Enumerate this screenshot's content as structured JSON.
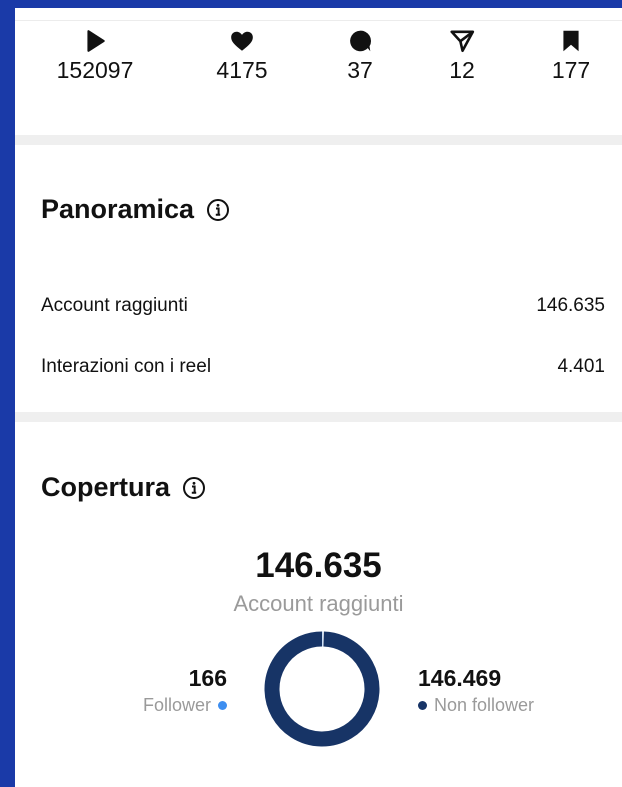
{
  "stats": [
    {
      "icon": "play-icon",
      "value": "152097"
    },
    {
      "icon": "heart-icon",
      "value": "4175"
    },
    {
      "icon": "comment-icon",
      "value": "37"
    },
    {
      "icon": "share-icon",
      "value": "12"
    },
    {
      "icon": "bookmark-icon",
      "value": "177"
    }
  ],
  "overview": {
    "title": "Panoramica",
    "rows": [
      {
        "label": "Account raggiunti",
        "value": "146.635"
      },
      {
        "label": "Interazioni con i reel",
        "value": "4.401"
      }
    ]
  },
  "reach": {
    "title": "Copertura",
    "total": "146.635",
    "total_label": "Account raggiunti",
    "followers": {
      "value": "166",
      "label": "Follower",
      "color": "#3d8ef0"
    },
    "non_followers": {
      "value": "146.469",
      "label": "Non follower",
      "color": "#173466"
    }
  },
  "chart_data": {
    "type": "pie",
    "categories": [
      "Follower",
      "Non follower"
    ],
    "values": [
      166,
      146469
    ],
    "colors": [
      "#3d8ef0",
      "#173466"
    ]
  },
  "colors": {
    "background": "#1a3aa8",
    "panel": "#ffffff",
    "separator": "#efefef"
  }
}
